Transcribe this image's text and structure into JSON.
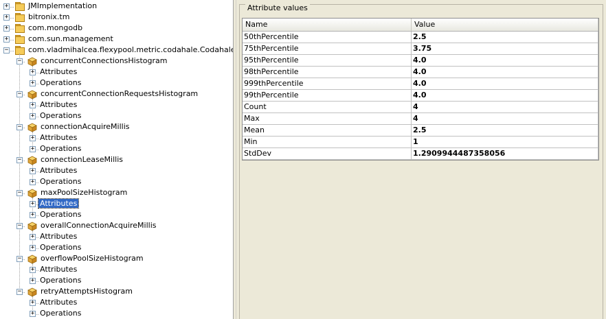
{
  "tree": {
    "roots": [
      {
        "label": "JMImplementation",
        "expanded": false
      },
      {
        "label": "bitronix.tm",
        "expanded": false
      },
      {
        "label": "com.mongodb",
        "expanded": false
      },
      {
        "label": "com.sun.management",
        "expanded": false
      },
      {
        "label": "com.vladmihalcea.flexypool.metric.codahale.CodahaleMetrics.",
        "expanded": true
      }
    ],
    "beans": [
      {
        "label": "concurrentConnectionsHistogram",
        "children": [
          "Attributes",
          "Operations"
        ]
      },
      {
        "label": "concurrentConnectionRequestsHistogram",
        "children": [
          "Attributes",
          "Operations"
        ]
      },
      {
        "label": "connectionAcquireMillis",
        "children": [
          "Attributes",
          "Operations"
        ]
      },
      {
        "label": "connectionLeaseMillis",
        "children": [
          "Attributes",
          "Operations"
        ]
      },
      {
        "label": "maxPoolSizeHistogram",
        "children": [
          "Attributes",
          "Operations"
        ]
      },
      {
        "label": "overallConnectionAcquireMillis",
        "children": [
          "Attributes",
          "Operations"
        ]
      },
      {
        "label": "overflowPoolSizeHistogram",
        "children": [
          "Attributes",
          "Operations"
        ]
      },
      {
        "label": "retryAttemptsHistogram",
        "children": [
          "Attributes",
          "Operations"
        ]
      }
    ],
    "selected": {
      "bean": 4,
      "child": 0
    }
  },
  "panel": {
    "title": "Attribute values",
    "columns": [
      "Name",
      "Value"
    ],
    "rows": [
      {
        "name": "50thPercentile",
        "value": "2.5"
      },
      {
        "name": "75thPercentile",
        "value": "3.75"
      },
      {
        "name": "95thPercentile",
        "value": "4.0"
      },
      {
        "name": "98thPercentile",
        "value": "4.0"
      },
      {
        "name": "999thPercentile",
        "value": "4.0"
      },
      {
        "name": "99thPercentile",
        "value": "4.0"
      },
      {
        "name": "Count",
        "value": "4"
      },
      {
        "name": "Max",
        "value": "4"
      },
      {
        "name": "Mean",
        "value": "2.5"
      },
      {
        "name": "Min",
        "value": "1"
      },
      {
        "name": "StdDev",
        "value": "1.2909944487358056"
      }
    ]
  },
  "icons": {
    "folder": "folder-icon",
    "bean": "mbean-icon",
    "expand": "expand-toggle-icon"
  },
  "colors": {
    "selection": "#3169c6",
    "folder": "#f6cc5a",
    "panel_bg": "#ece9d8"
  }
}
